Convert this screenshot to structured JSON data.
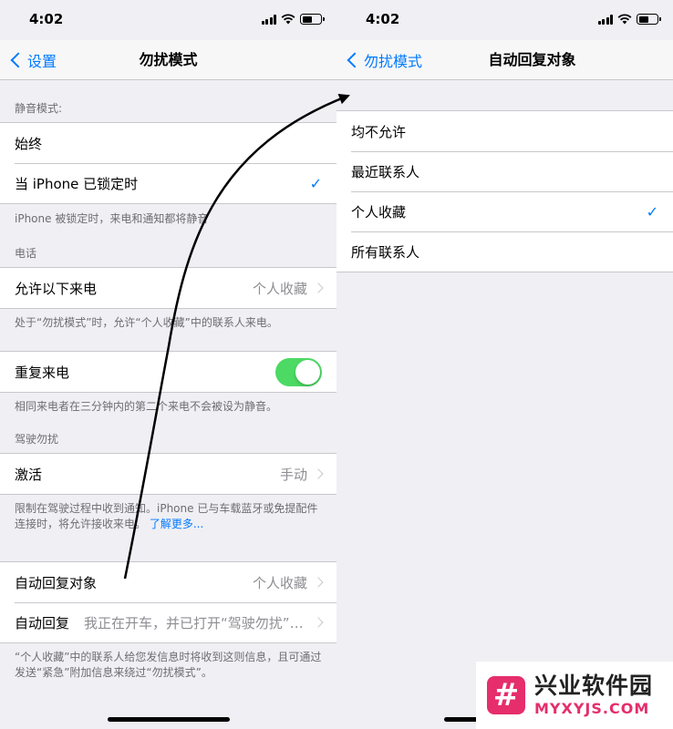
{
  "left": {
    "status": {
      "time": "4:02"
    },
    "nav": {
      "back": "设置",
      "title": "勿扰模式"
    },
    "silence": {
      "header": "静音模式:",
      "items": [
        {
          "label": "始终"
        },
        {
          "label": "当 iPhone 已锁定时",
          "checked": true
        }
      ],
      "footer": "iPhone 被锁定时，来电和通知都将静音"
    },
    "phone": {
      "header": "电话",
      "allow_calls": {
        "label": "允许以下来电",
        "value": "个人收藏"
      },
      "footer": "处于“勿扰模式”时，允许“个人收藏”中的联系人来电。"
    },
    "repeat": {
      "label": "重复来电",
      "on": true,
      "footer": "相同来电者在三分钟内的第二个来电不会被设为静音。"
    },
    "driving": {
      "header": "驾驶勿扰",
      "activate": {
        "label": "激活",
        "value": "手动"
      },
      "footer": "限制在驾驶过程中收到通知。iPhone 已与车载蓝牙或免提配件连接时，将允许接收来电。",
      "learn_more": "了解更多..."
    },
    "auto_reply": {
      "to": {
        "label": "自动回复对象",
        "value": "个人收藏"
      },
      "reply": {
        "label": "自动回复",
        "value": "我正在开车，并已打开“驾驶勿扰”。我看到此信息时会回复您。"
      },
      "footer": "“个人收藏”中的联系人给您发信息时将收到这则信息，且可通过发送“紧急”附加信息来绕过“勿扰模式”。"
    }
  },
  "right": {
    "status": {
      "time": "4:02"
    },
    "nav": {
      "back": "勿扰模式",
      "title": "自动回复对象"
    },
    "options": [
      {
        "label": "均不允许"
      },
      {
        "label": "最近联系人"
      },
      {
        "label": "个人收藏",
        "checked": true
      },
      {
        "label": "所有联系人"
      }
    ],
    "check_glyph": "✓"
  },
  "watermark": {
    "logo": "#",
    "title": "兴业软件园",
    "url": "MYXYJS.COM"
  },
  "colors": {
    "accent": "#007aff",
    "toggle_on": "#4cd964",
    "watermark": "#e52e6b"
  }
}
